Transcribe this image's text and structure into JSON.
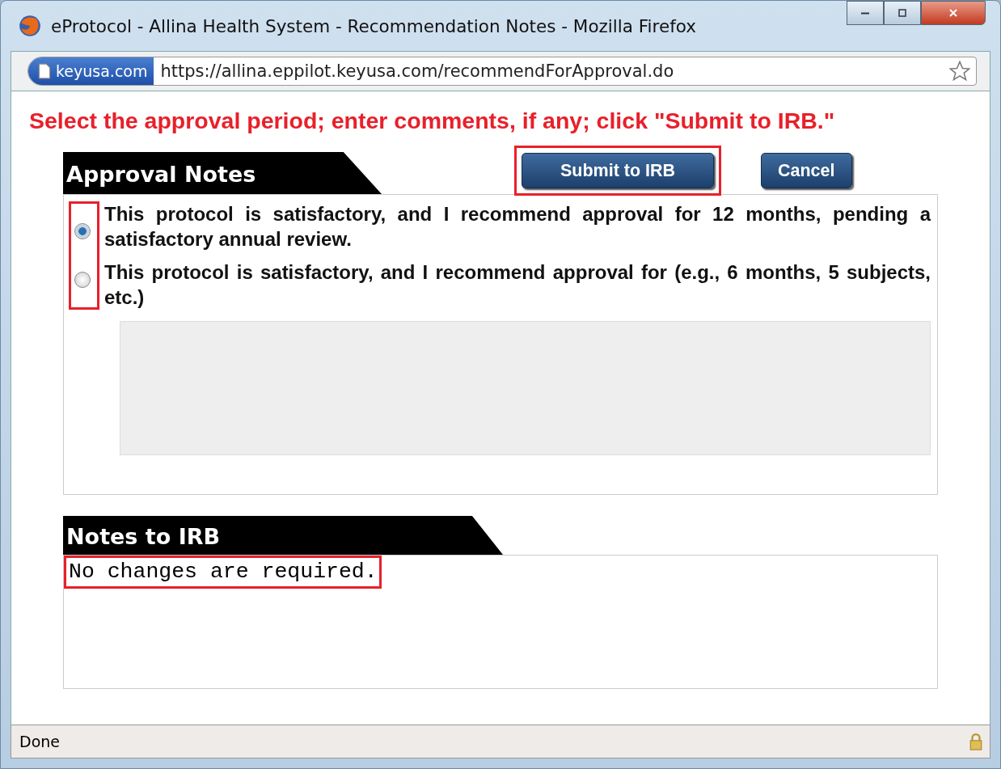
{
  "window": {
    "title": "eProtocol - Allina Health System - Recommendation Notes - Mozilla Firefox"
  },
  "address_bar": {
    "site_badge": "keyusa.com",
    "url": "https://allina.eppilot.keyusa.com/recommendForApproval.do"
  },
  "instruction": "Select the approval period; enter comments, if any; click \"Submit to IRB.\"",
  "approval_notes": {
    "heading": "Approval Notes",
    "buttons": [
      {
        "label": "Submit to IRB",
        "highlighted": true
      },
      {
        "label": "Cancel",
        "highlighted": false
      }
    ],
    "options_highlighted": true,
    "options": [
      {
        "label": "This protocol is satisfactory, and I recommend approval for 12 months, pending a satisfactory annual review.",
        "selected": true
      },
      {
        "label": "This protocol is satisfactory, and I recommend approval for (e.g., 6 months, 5 subjects, etc.)",
        "selected": false
      }
    ]
  },
  "notes_to_irb": {
    "heading": "Notes to IRB",
    "value": "No changes are required.",
    "highlighted": true
  },
  "status_bar": {
    "text": "Done"
  }
}
